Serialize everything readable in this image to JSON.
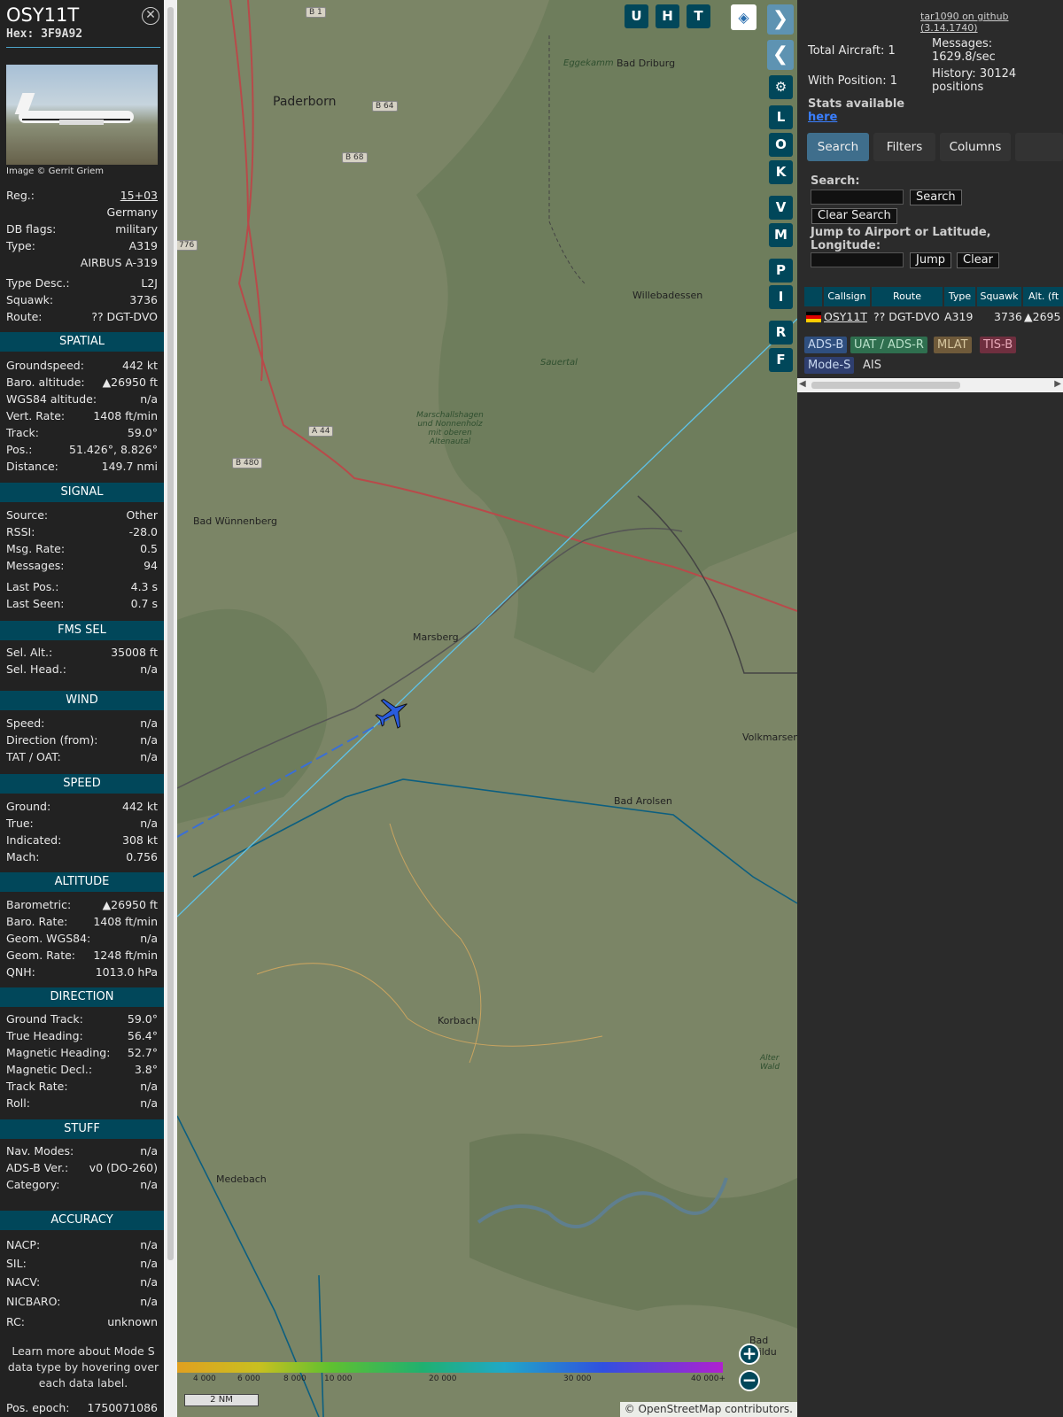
{
  "aircraft": {
    "callsign": "OSY11T",
    "hex_label": "Hex:",
    "hex": "3F9A92",
    "image_credit": "Image © Gerrit Griem",
    "reg_rows": [
      {
        "key": "Reg.:",
        "value": "15+03"
      },
      {
        "key": "",
        "value": "Germany"
      },
      {
        "key": "DB flags:",
        "value": "military"
      },
      {
        "key": "Type:",
        "value": "A319"
      },
      {
        "key": "",
        "value": "AIRBUS A-319"
      },
      {
        "key": "Type Desc.:",
        "value": "L2J"
      },
      {
        "key": "Squawk:",
        "value": "3736"
      },
      {
        "key": "Route:",
        "value": "?? DGT-DVO"
      }
    ]
  },
  "sections": [
    {
      "title": "SPATIAL",
      "rows": [
        {
          "key": "Groundspeed:",
          "value": "442 kt"
        },
        {
          "key": "Baro. altitude:",
          "value": "▲26950 ft"
        },
        {
          "key": "WGS84 altitude:",
          "value": "n/a"
        },
        {
          "key": "Vert. Rate:",
          "value": "1408 ft/min"
        },
        {
          "key": "Track:",
          "value": "59.0°"
        },
        {
          "key": "Pos.:",
          "value": "51.426°, 8.826°"
        },
        {
          "key": "Distance:",
          "value": "149.7 nmi"
        }
      ]
    },
    {
      "title": "SIGNAL",
      "rows": [
        {
          "key": "Source:",
          "value": "Other"
        },
        {
          "key": "RSSI:",
          "value": "-28.0"
        },
        {
          "key": "Msg. Rate:",
          "value": "0.5"
        },
        {
          "key": "Messages:",
          "value": "94"
        },
        {
          "key": "Last Pos.:",
          "value": "4.3 s"
        },
        {
          "key": "Last Seen:",
          "value": "0.7 s"
        }
      ]
    },
    {
      "title": "FMS SEL",
      "rows": [
        {
          "key": "Sel. Alt.:",
          "value": "35008 ft"
        },
        {
          "key": "Sel. Head.:",
          "value": "n/a"
        }
      ]
    },
    {
      "title": "WIND",
      "rows": [
        {
          "key": "Speed:",
          "value": "n/a"
        },
        {
          "key": "Direction (from):",
          "value": "n/a"
        },
        {
          "key": "TAT / OAT:",
          "value": "n/a"
        }
      ]
    },
    {
      "title": "SPEED",
      "rows": [
        {
          "key": "Ground:",
          "value": "442 kt"
        },
        {
          "key": "True:",
          "value": "n/a"
        },
        {
          "key": "Indicated:",
          "value": "308 kt"
        },
        {
          "key": "Mach:",
          "value": "0.756"
        }
      ]
    },
    {
      "title": "ALTITUDE",
      "rows": [
        {
          "key": "Barometric:",
          "value": "▲26950 ft"
        },
        {
          "key": "Baro. Rate:",
          "value": "1408 ft/min"
        },
        {
          "key": "Geom. WGS84:",
          "value": "n/a"
        },
        {
          "key": "Geom. Rate:",
          "value": "1248 ft/min"
        },
        {
          "key": "QNH:",
          "value": "1013.0 hPa"
        }
      ]
    },
    {
      "title": "DIRECTION",
      "rows": [
        {
          "key": "Ground Track:",
          "value": "59.0°"
        },
        {
          "key": "True Heading:",
          "value": "56.4°"
        },
        {
          "key": "Magnetic Heading:",
          "value": "52.7°"
        },
        {
          "key": "Magnetic Decl.:",
          "value": "3.8°"
        },
        {
          "key": "Track Rate:",
          "value": "n/a"
        },
        {
          "key": "Roll:",
          "value": "n/a"
        }
      ]
    },
    {
      "title": "STUFF",
      "rows": [
        {
          "key": "Nav. Modes:",
          "value": "n/a"
        },
        {
          "key": "ADS-B Ver.:",
          "value": "v0 (DO-260)"
        },
        {
          "key": "Category:",
          "value": "n/a"
        }
      ]
    },
    {
      "title": "ACCURACY",
      "rows": [
        {
          "key": "NACP:",
          "value": "n/a"
        },
        {
          "key": "SIL:",
          "value": "n/a"
        },
        {
          "key": "NACV:",
          "value": "n/a"
        },
        {
          "key": "NICBARO:",
          "value": "n/a"
        },
        {
          "key": "RC:",
          "value": "unknown"
        }
      ]
    }
  ],
  "footer_note": "Learn more about Mode S data type by hovering over each data label.",
  "pos_epoch": {
    "key": "Pos. epoch:",
    "value": "1750071086"
  },
  "map": {
    "places": [
      "Paderborn",
      "Bad Driburg",
      "Willebadessen",
      "Bad Wünnenberg",
      "Marsberg",
      "Volkmarsen",
      "Bad Arolsen",
      "Korbach",
      "Medebach",
      "Bad Wildu",
      "Eggekamm",
      "Sauertal",
      "Marschallshagen und Nonnenholz mit oberen Altenautal",
      "Alter Wald"
    ],
    "roads": [
      "B 1",
      "B 64",
      "B 68",
      "A 44",
      "B 480",
      "776"
    ],
    "top_buttons": [
      "U",
      "H",
      "T"
    ],
    "side_buttons": [
      "L",
      "O",
      "K",
      "V",
      "M",
      "P",
      "I",
      "R",
      "F"
    ],
    "altitude_scale": [
      "4 000",
      "6 000",
      "8 000",
      "10 000",
      "20 000",
      "30 000",
      "40 000+"
    ],
    "scale_label": "2 NM",
    "attribution": "© OpenStreetMap contributors."
  },
  "right": {
    "github_link": "tar1090 on github (3.14.1740)",
    "total_aircraft": "Total Aircraft: 1",
    "with_position": "With Position: 1",
    "messages": "Messages: 1629.8/sec",
    "history": "History: 30124 positions",
    "stats_text": "Stats available",
    "stats_link": "here",
    "tabs": [
      "Search",
      "Filters",
      "Columns"
    ],
    "search_label": "Search:",
    "search_button": "Search",
    "clear_search_button": "Clear Search",
    "jump_label": "Jump to Airport or Latitude, Longitude:",
    "jump_button": "Jump",
    "clear_button": "Clear",
    "table_headers": [
      "Callsign",
      "Route",
      "Type",
      "Squawk",
      "Alt. (ft"
    ],
    "table_row": {
      "callsign": "OSY11T",
      "route": "?? DGT-DVO",
      "type": "A319",
      "squawk": "3736",
      "alt": "▲2695"
    },
    "badges": [
      {
        "label": "ADS-B",
        "color": "#2f4f7f"
      },
      {
        "label": "UAT / ADS-R",
        "color": "#2f6f4f"
      },
      {
        "label": "MLAT",
        "color": "#6f5a3a"
      },
      {
        "label": "TIS-B",
        "color": "#6f2f3f"
      },
      {
        "label": "Mode-S",
        "color": "#2f3f6f"
      },
      {
        "label": "AIS",
        "color": "#2b2b2b"
      }
    ]
  }
}
